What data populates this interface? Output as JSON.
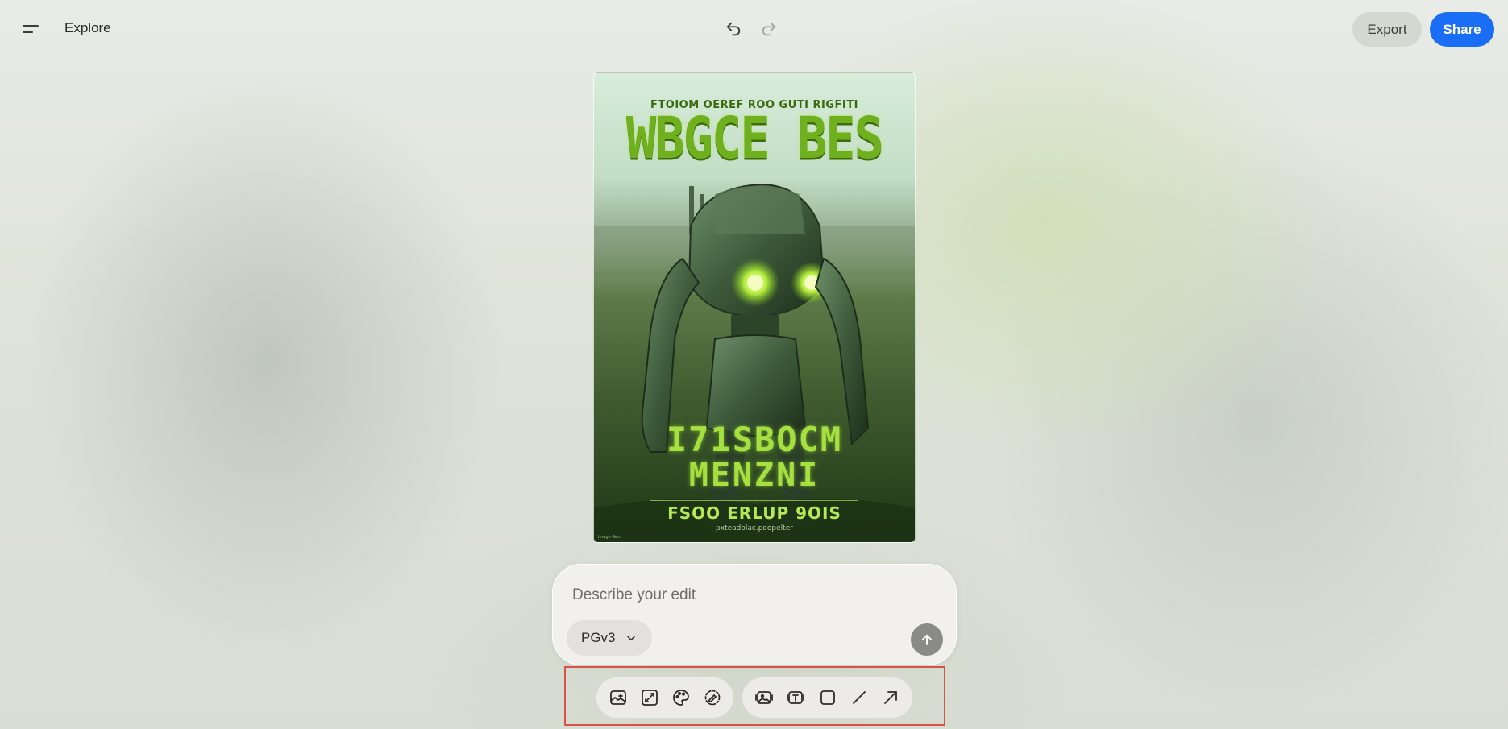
{
  "header": {
    "explore_label": "Explore",
    "export_label": "Export",
    "share_label": "Share"
  },
  "poster": {
    "top_line": "FTOIOM OEREF ROO GUTI RIGFITI",
    "title": "WBGCE BES",
    "line1": "I71SBOCM",
    "line2": "MENZNI",
    "line3": "FSOO ERLUP 9OIS",
    "url": "pxteadolac.poopelter",
    "corner": "Image Gen"
  },
  "prompt": {
    "placeholder": "Describe your edit",
    "model": "PGv3"
  },
  "toolbar": {
    "group1": [
      "add-image",
      "expand",
      "palette",
      "erase"
    ],
    "group2": [
      "image-frame",
      "text-frame",
      "rectangle",
      "line",
      "arrow"
    ]
  },
  "colors": {
    "accent": "#1a6ef5",
    "highlight_frame": "#d8524a",
    "send_button": "#8a8a87"
  }
}
